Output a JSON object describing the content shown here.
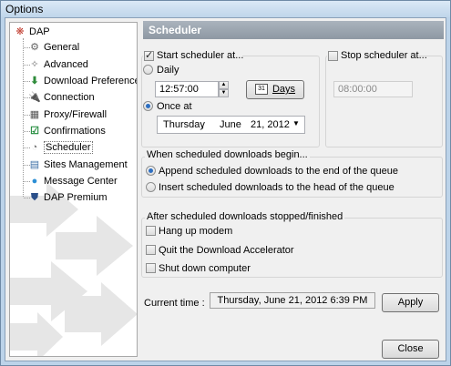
{
  "window": {
    "title": "Options"
  },
  "tree": {
    "root": "DAP",
    "items": [
      {
        "label": "General",
        "icon": "general-icon"
      },
      {
        "label": "Advanced",
        "icon": "advanced-icon"
      },
      {
        "label": "Download Preferences",
        "icon": "download-preferences-icon"
      },
      {
        "label": "Connection",
        "icon": "connection-icon"
      },
      {
        "label": "Proxy/Firewall",
        "icon": "proxy-firewall-icon"
      },
      {
        "label": "Confirmations",
        "icon": "confirmations-icon"
      },
      {
        "label": "Scheduler",
        "icon": "scheduler-icon",
        "selected": true
      },
      {
        "label": "Sites Management",
        "icon": "sites-management-icon"
      },
      {
        "label": "Message Center",
        "icon": "message-center-icon"
      },
      {
        "label": "DAP Premium",
        "icon": "dap-premium-icon"
      }
    ]
  },
  "panel": {
    "title": "Scheduler"
  },
  "start": {
    "label": "Start scheduler at...",
    "checked": true,
    "daily_label": "Daily",
    "time_value": "12:57:00",
    "days_label": "Days",
    "days_icon_text": "31",
    "once_label": "Once at",
    "date": {
      "weekday": "Thursday",
      "sep": ",",
      "month": "June",
      "day": "21, 2012"
    }
  },
  "stop": {
    "label": "Stop scheduler at...",
    "checked": false,
    "time_value": "08:00:00"
  },
  "begin": {
    "title": "When scheduled downloads begin...",
    "append_label": "Append scheduled downloads to  the end of the queue",
    "insert_label": "Insert scheduled downloads to  the head of the queue"
  },
  "after": {
    "title": "After scheduled downloads stopped/finished",
    "hangup_label": "Hang up modem",
    "quit_label": "Quit the Download Accelerator",
    "shutdown_label": "Shut down computer"
  },
  "current_time": {
    "label": "Current time :",
    "value": "Thursday, June 21, 2012 6:39 PM"
  },
  "buttons": {
    "apply": "Apply",
    "close": "Close"
  },
  "colors": {
    "accent": "#2d6fc2",
    "header": "#9aa3ad"
  }
}
